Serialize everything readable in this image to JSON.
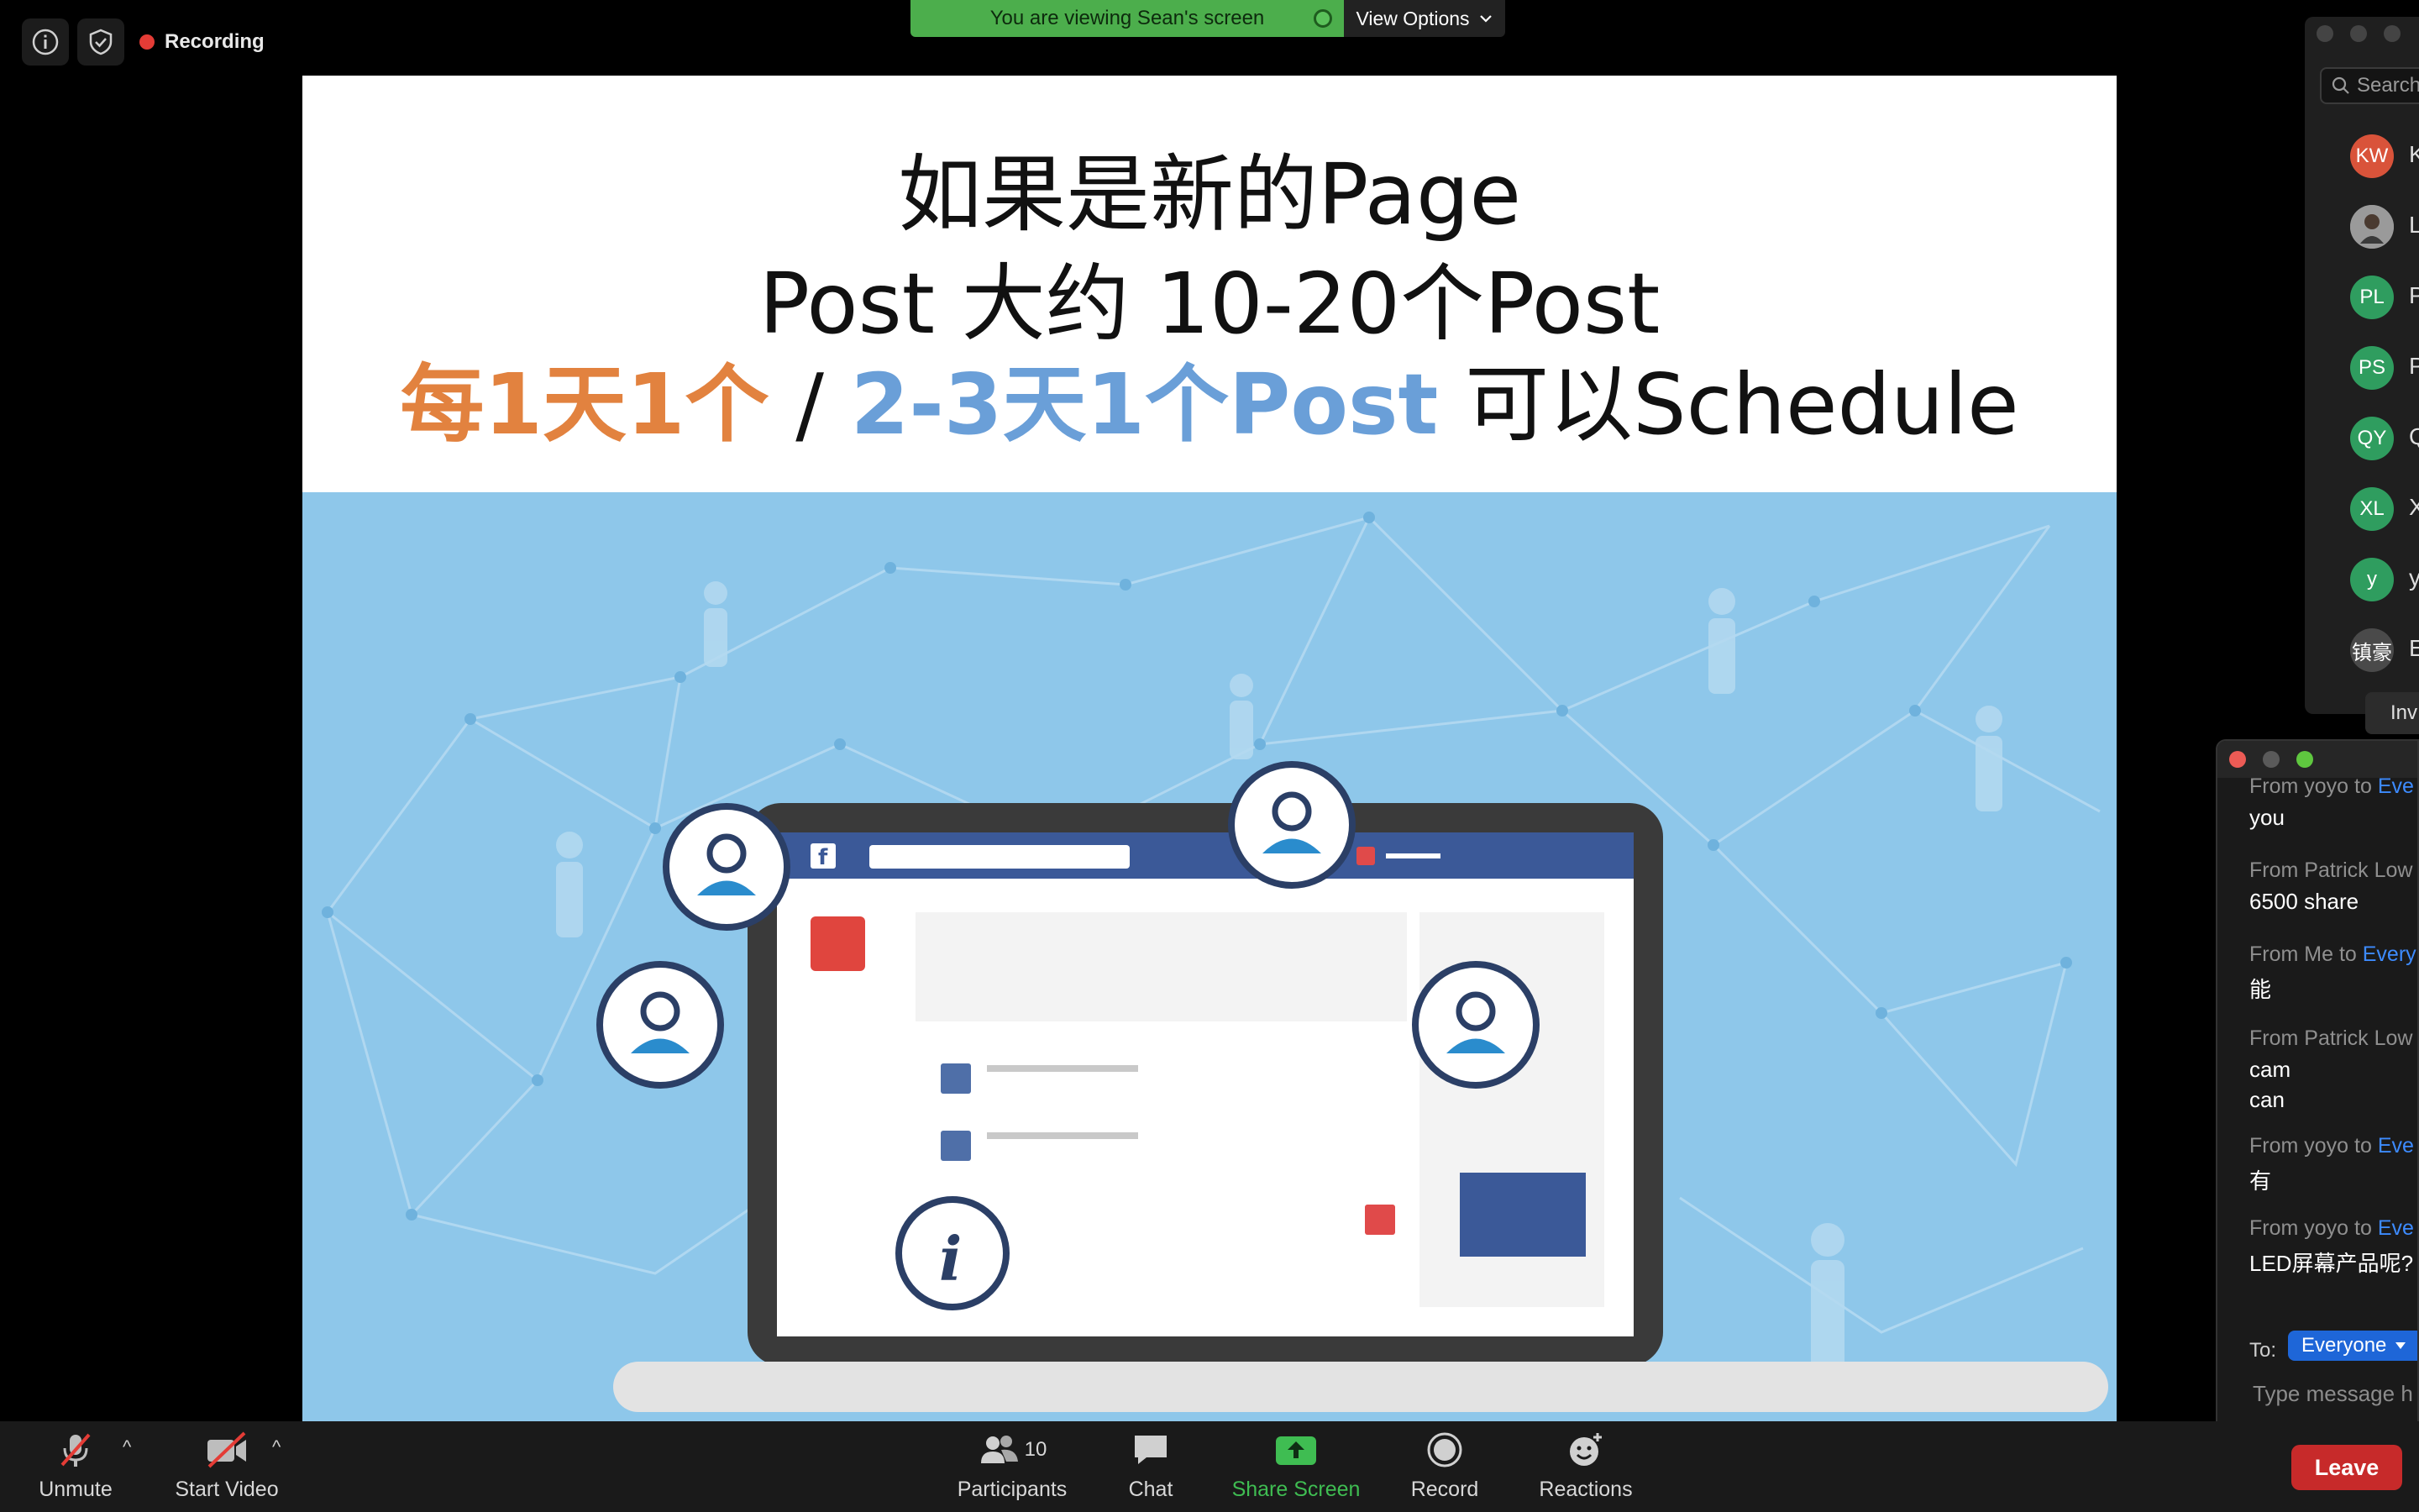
{
  "app": {
    "recording_label": "Recording",
    "banner_text": "You are viewing Sean's screen",
    "view_options_label": "View Options",
    "colors": {
      "accent_green": "#4cae4c",
      "record_red": "#e43c36",
      "chat_blue": "#3d8bff",
      "leave_red": "#c72a2a"
    }
  },
  "slide": {
    "line1": "如果是新的Page",
    "line2": "Post 大约 10-20个Post",
    "line3_orange": "每1天1个",
    "line3_sep": " / ",
    "line3_blue": "2-3天1个Post",
    "line3_tail": " 可以Schedule",
    "illustration": "facebook-page-network-illustration"
  },
  "participants_panel": {
    "search_placeholder": "Search",
    "avatars": [
      {
        "initials": "KW",
        "name_initial": "K",
        "color": "#d9533a"
      },
      {
        "initials": "",
        "name_initial": "L",
        "color": "#8a8a8a"
      },
      {
        "initials": "PL",
        "name_initial": "P",
        "color": "#2f9d5f"
      },
      {
        "initials": "PS",
        "name_initial": "P",
        "color": "#2f9d5f"
      },
      {
        "initials": "QY",
        "name_initial": "Q",
        "color": "#2f9d5f"
      },
      {
        "initials": "XL",
        "name_initial": "X",
        "color": "#2f9d5f"
      },
      {
        "initials": "y",
        "name_initial": "y",
        "color": "#2f9d5f"
      },
      {
        "initials": "镇豪",
        "name_initial": "E",
        "color": "#4a4a4a"
      }
    ],
    "invite_label": "Inv"
  },
  "chat": {
    "messages": [
      {
        "from": "From yoyo to ",
        "to": "Eve",
        "lines": [
          "you"
        ]
      },
      {
        "from": "From Patrick Low",
        "to": "",
        "lines": [
          "6500 share"
        ]
      },
      {
        "from": "From Me to ",
        "to": "Every",
        "lines": [
          "能"
        ]
      },
      {
        "from": "From Patrick Low",
        "to": "",
        "lines": [
          "cam",
          "can"
        ]
      },
      {
        "from": "From yoyo to ",
        "to": "Eve",
        "lines": [
          "有"
        ]
      },
      {
        "from": "From yoyo to ",
        "to": "Eve",
        "lines": [
          "LED屏幕产品呢?"
        ]
      }
    ],
    "to_label": "To:",
    "to_value": "Everyone",
    "input_placeholder": "Type message h"
  },
  "toolbar": {
    "unmute": "Unmute",
    "start_video": "Start Video",
    "participants": "Participants",
    "participants_count": "10",
    "chat": "Chat",
    "share_screen": "Share Screen",
    "record": "Record",
    "reactions": "Reactions",
    "leave": "Leave"
  }
}
